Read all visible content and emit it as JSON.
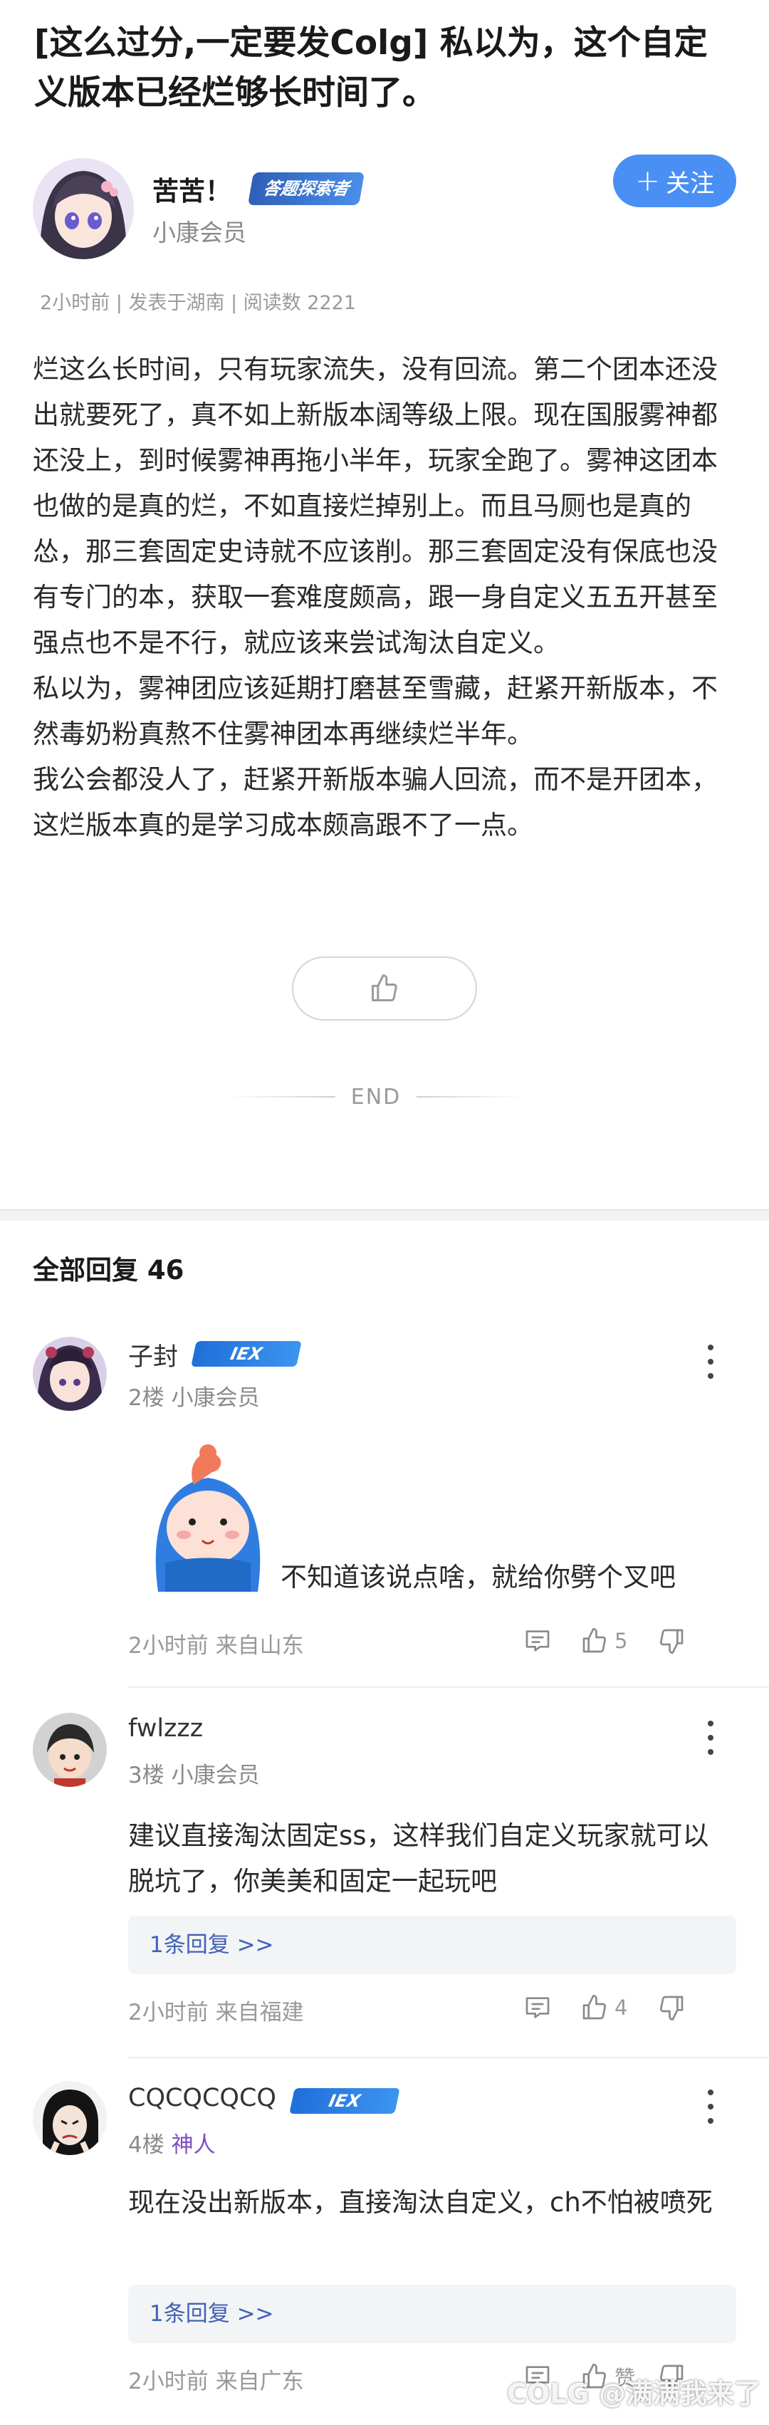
{
  "post": {
    "title": "[这么过分,一定要发Colg] 私以为，这个自定义版本已经烂够长时间了。",
    "author": {
      "name": "苦苦！",
      "badge": "答题探索者",
      "level": "小康会员"
    },
    "follow_label": "关注",
    "meta": "2小时前 | 发表于湖南 | 阅读数 2221",
    "body": [
      "烂这么长时间，只有玩家流失，没有回流。第二个团本还没出就要死了，真不如上新版本阔等级上限。现在国服雾神都还没上，到时候雾神再拖小半年，玩家全跑了。雾神这团本也做的是真的烂，不如直接烂掉别上。而且马厕也是真的怂，那三套固定史诗就不应该削。那三套固定没有保底也没有专门的本，获取一套难度颇高，跟一身自定义五五开甚至强点也不是不行，就应该来尝试淘汰自定义。",
      "私以为，雾神团应该延期打磨甚至雪藏，赶紧开新版本，不然毒奶粉真熬不住雾神团本再继续烂半年。",
      "我公会都没人了，赶紧开新版本骗人回流，而不是开团本，这烂版本真的是学习成本颇高跟不了一点。"
    ],
    "end_label": "END"
  },
  "replies": {
    "header": "全部回复  46",
    "items": [
      {
        "name": "子封",
        "badge": "IEX",
        "floor": "2楼",
        "role": "小康会员",
        "text": "不知道该说点啥，就给你劈个叉吧",
        "footer": "2小时前 来自山东",
        "likes": "5"
      },
      {
        "name": "fwlzzz",
        "floor": "3楼",
        "role": "小康会员",
        "text": "建议直接淘汰固定ss，这样我们自定义玩家就可以脱坑了，你美美和固定一起玩吧",
        "sub_replies": "1条回复 >>",
        "footer": "2小时前 来自福建",
        "likes": "4"
      },
      {
        "name": "CQCQCQCQ",
        "badge": "IEX",
        "floor": "4楼",
        "role": "神人",
        "text": "现在没出新版本，直接淘汰自定义，ch不怕被喷死",
        "sub_replies": "1条回复 >>",
        "footer": "2小时前 来自广东",
        "likes": "赞"
      }
    ]
  },
  "watermark": "COLG @满满我来了",
  "colors": {
    "accent": "#4a8ff3",
    "link": "#4262b5",
    "special_role": "#7d4fbf"
  }
}
